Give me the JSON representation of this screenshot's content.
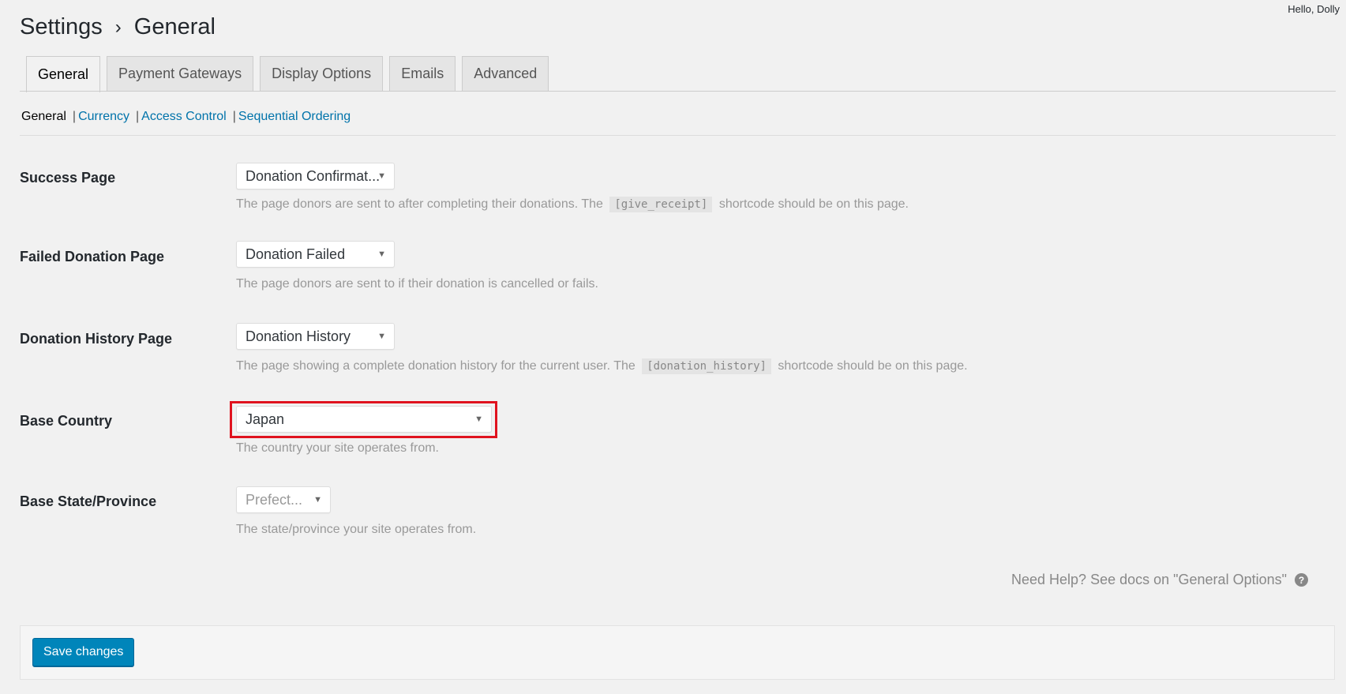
{
  "header": {
    "greeting": "Hello, Dolly",
    "title_parent": "Settings",
    "title_separator": "›",
    "title_current": "General"
  },
  "tabs": [
    {
      "label": "General",
      "active": true
    },
    {
      "label": "Payment Gateways",
      "active": false
    },
    {
      "label": "Display Options",
      "active": false
    },
    {
      "label": "Emails",
      "active": false
    },
    {
      "label": "Advanced",
      "active": false
    }
  ],
  "subnav": {
    "current": "General",
    "separator": "|",
    "links": [
      "Currency",
      "Access Control",
      "Sequential Ordering"
    ]
  },
  "fields": {
    "success_page": {
      "label": "Success Page",
      "value": "Donation Confirmat...",
      "desc_before": "The page donors are sent to after completing their donations. The",
      "code": "[give_receipt]",
      "desc_after": "shortcode should be on this page."
    },
    "failed_page": {
      "label": "Failed Donation Page",
      "value": "Donation Failed",
      "desc": "The page donors are sent to if their donation is cancelled or fails."
    },
    "history_page": {
      "label": "Donation History Page",
      "value": "Donation History",
      "desc_before": "The page showing a complete donation history for the current user. The",
      "code": "[donation_history]",
      "desc_after": "shortcode should be on this page."
    },
    "base_country": {
      "label": "Base Country",
      "value": "Japan",
      "desc": "The country your site operates from."
    },
    "base_state": {
      "label": "Base State/Province",
      "placeholder": "Prefect...",
      "desc": "The state/province your site operates from."
    }
  },
  "help": {
    "text": "Need Help? See docs on \"General Options\"",
    "icon": "question-circle-icon",
    "icon_glyph": "?"
  },
  "footer": {
    "save_label": "Save changes"
  },
  "colors": {
    "accent": "#0085ba",
    "link": "#0073aa",
    "highlight": "#e0131f"
  }
}
